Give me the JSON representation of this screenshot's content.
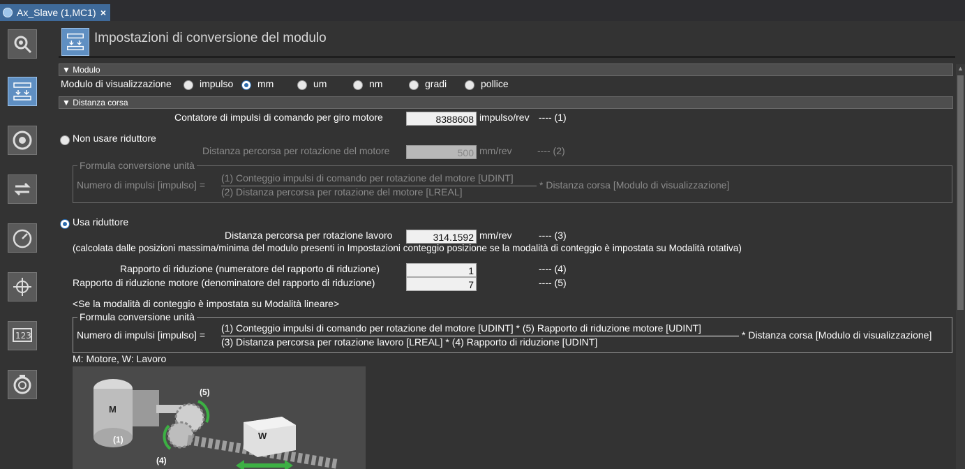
{
  "tab": {
    "label": "Ax_Slave (1,MC1)",
    "close_glyph": "×"
  },
  "page": {
    "title": "Impostazioni di conversione del modulo"
  },
  "nav_icons": [
    "axis-settings-icon",
    "unit-conversion-icon",
    "operation-settings-icon",
    "other-operation-icon",
    "limit-settings-icon",
    "position-count-icon",
    "servo-drive-icon",
    "homing-icon"
  ],
  "unit_section": {
    "header": "▼ Modulo",
    "display_unit_label": "Modulo di visualizzazione",
    "options": [
      "impulso",
      "mm",
      "um",
      "nm",
      "gradi",
      "pollice"
    ],
    "selected": "mm"
  },
  "travel_section": {
    "header": "▼ Distanza corsa",
    "pulse_count_label": "Contatore di impulsi di comando per giro motore",
    "pulse_count_value": "8388608",
    "pulse_count_unit": "impulso/rev",
    "pulse_count_ref": "---- (1)",
    "no_reducer_label": "Non usare riduttore",
    "travel_per_rev_label": "Distanza percorsa per rotazione del motore",
    "travel_per_rev_value": "500",
    "travel_per_rev_unit": "mm/rev",
    "travel_per_rev_ref": "---- (2)",
    "formula1": {
      "legend": "Formula conversione unità",
      "lhs": "Numero di impulsi [impulso] =",
      "numerator": "(1) Conteggio impulsi di comando per rotazione del motore [UDINT]",
      "denominator": "(2) Distanza percorsa per rotazione del motore [LREAL]",
      "rhs": "* Distanza corsa [Modulo di visualizzazione]"
    },
    "use_reducer_label": "Usa riduttore",
    "work_travel_label": "Distanza percorsa per rotazione lavoro",
    "work_travel_value": "314.1592",
    "work_travel_unit": "mm/rev",
    "work_travel_ref": "---- (3)",
    "work_travel_note": "(calcolata dalle posizioni massima/minima del modulo presenti in Impostazioni conteggio posizione se la modalità di conteggio è impostata su Modalità rotativa)",
    "gear_num_label": "Rapporto di riduzione (numeratore del rapporto di riduzione)",
    "gear_num_value": "1",
    "gear_num_ref": "---- (4)",
    "gear_den_label": "Rapporto di riduzione motore (denominatore del rapporto di riduzione)",
    "gear_den_value": "7",
    "gear_den_ref": "---- (5)",
    "linear_note": "<Se la modalità di conteggio è impostata su Modalità lineare>",
    "formula2": {
      "legend": "Formula conversione unità",
      "lhs": "Numero di impulsi [impulso] =",
      "numerator": "(1) Conteggio impulsi di comando per rotazione del motore [UDINT] * (5) Rapporto di riduzione motore [UDINT]",
      "denominator": "(3) Distanza percorsa per rotazione lavoro [LREAL] * (4) Rapporto di riduzione [UDINT]",
      "rhs": "* Distanza corsa [Modulo di visualizzazione]"
    },
    "legend_note": "M: Motore, W: Lavoro",
    "diagram": {
      "motor": "M",
      "work": "W",
      "label_1": "(1)",
      "label_4": "(4)",
      "label_5": "(5)"
    }
  },
  "colors": {
    "accent": "#3f6a9a",
    "nav_active": "#5f8fc2",
    "background": "#333333",
    "green_arrow": "#3cb043"
  }
}
